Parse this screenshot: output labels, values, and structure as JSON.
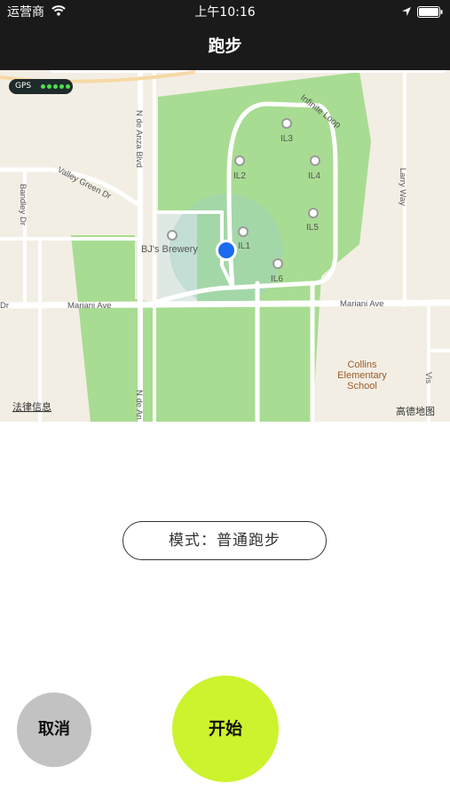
{
  "status_bar": {
    "carrier": "运营商",
    "time": "上午10:16",
    "wifi_icon": "wifi-icon",
    "location_icon": "location-arrow-icon",
    "battery_icon": "battery-icon"
  },
  "nav": {
    "title": "跑步"
  },
  "map": {
    "gps_label": "GPS",
    "gps_signal_bars": 5,
    "labels": {
      "infinite_loop": "Infinite Loop",
      "valley_green": "Valley Green Dr",
      "bandley": "Bandley Dr",
      "de_anza_upper": "N de Anza Blvd",
      "de_anza_lower": "N de An",
      "larry_way": "Larry Way",
      "mariani_left": "Mariani Ave",
      "mariani_right": "Mariani Ave",
      "dr_left": "Dr",
      "bjs": "BJ's Brewery",
      "il1": "IL1",
      "il2": "IL2",
      "il3": "IL3",
      "il4": "IL4",
      "il5": "IL5",
      "il6": "IL6",
      "school_line1": "Collins",
      "school_line2": "Elementary",
      "school_line3": "School",
      "legal": "法律信息",
      "brand": "高德地图",
      "vis": "Vis"
    },
    "colors": {
      "background": "#f3eee4",
      "park": "#a8dc92",
      "road": "#ffffff",
      "label": "#555555",
      "school": "#9a5a2a",
      "location_dot": "#1a6bf0"
    }
  },
  "mode": {
    "label": "模式：普通跑步"
  },
  "actions": {
    "cancel_label": "取消",
    "start_label": "开始",
    "cancel_color": "#c2c2c2",
    "start_color": "#ccf32d"
  }
}
